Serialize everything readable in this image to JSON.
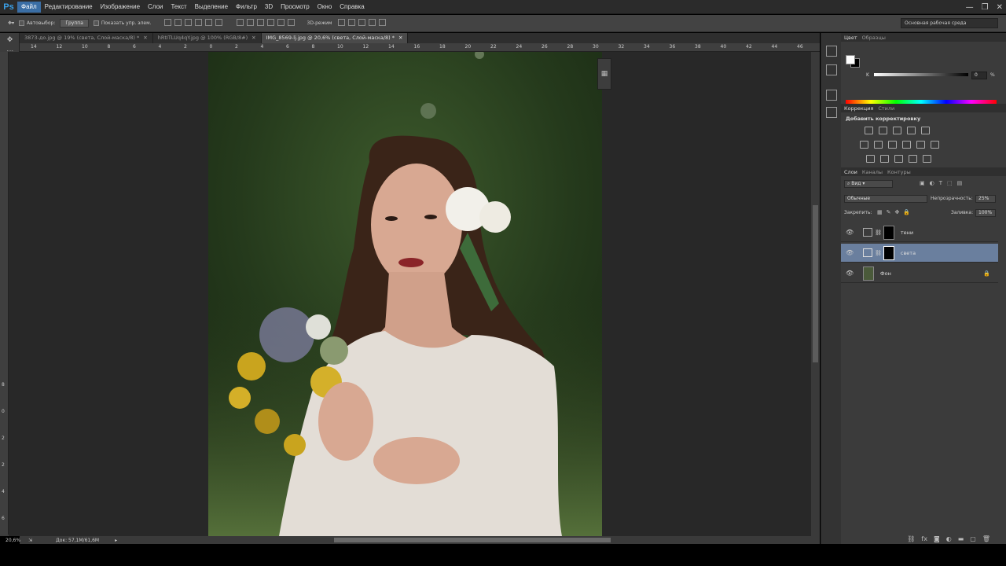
{
  "app": {
    "logo": "Ps"
  },
  "menu": [
    "Файл",
    "Редактирование",
    "Изображение",
    "Слои",
    "Текст",
    "Выделение",
    "Фильтр",
    "3D",
    "Просмотр",
    "Окно",
    "Справка"
  ],
  "options": {
    "autoselect_label": "Автовыбор:",
    "autoselect_value": "Группа",
    "show_transform_label": "Показать упр. элем.",
    "mode_3d": "3D-режим",
    "workspace": "Основная рабочая среда"
  },
  "tabs": [
    {
      "label": "3873-до.jpg @ 19% (света, Слой-маска/8) *",
      "active": false
    },
    {
      "label": "hRtITLUq4qY.jpg @ 100% (RGB/8#)",
      "active": false
    },
    {
      "label": "IMG_8569-lj.jpg @ 20,6% (света, Слой-маска/8) *",
      "active": true
    }
  ],
  "ruler_h": [
    "14",
    "12",
    "10",
    "8",
    "6",
    "4",
    "2",
    "0",
    "2",
    "4",
    "6",
    "8",
    "10",
    "12",
    "14",
    "16",
    "18",
    "20",
    "22",
    "24",
    "26",
    "28",
    "30",
    "32",
    "34",
    "36",
    "38",
    "40",
    "42",
    "44",
    "46"
  ],
  "ruler_v": [
    "8",
    "0",
    "2",
    "2",
    "4",
    "6"
  ],
  "status": {
    "zoom": "20,6%",
    "doc": "Док: 57,1M/61,6M"
  },
  "color_panel": {
    "tab_color": "Цвет",
    "tab_swatches": "Образцы",
    "channel": "K",
    "value": "0",
    "unit": "%"
  },
  "adjustments": {
    "tab": "Коррекция",
    "tab2": "Стили",
    "title": "Добавить корректировку"
  },
  "layers": {
    "tab_layers": "Слои",
    "tab_channels": "Каналы",
    "tab_paths": "Контуры",
    "filter": "Вид",
    "blend": "Обычные",
    "opacity_label": "Непрозрачность:",
    "opacity": "25%",
    "lock_label": "Закрепить:",
    "fill_label": "Заливка:",
    "fill": "100%",
    "items": [
      {
        "name": "тени",
        "selected": false
      },
      {
        "name": "света",
        "selected": true
      },
      {
        "name": "Фон",
        "selected": false
      }
    ]
  },
  "icons": {
    "move": "move-tool-icon",
    "eye": "eye-icon",
    "lock": "lock-icon",
    "link": "chain-link-icon",
    "trash": "trash-icon",
    "folder": "folder-icon"
  },
  "colors": {
    "selected_layer": "#6a7f9e",
    "menu_active": "#3a6ea5",
    "ps_blue": "#3aa0e8"
  }
}
